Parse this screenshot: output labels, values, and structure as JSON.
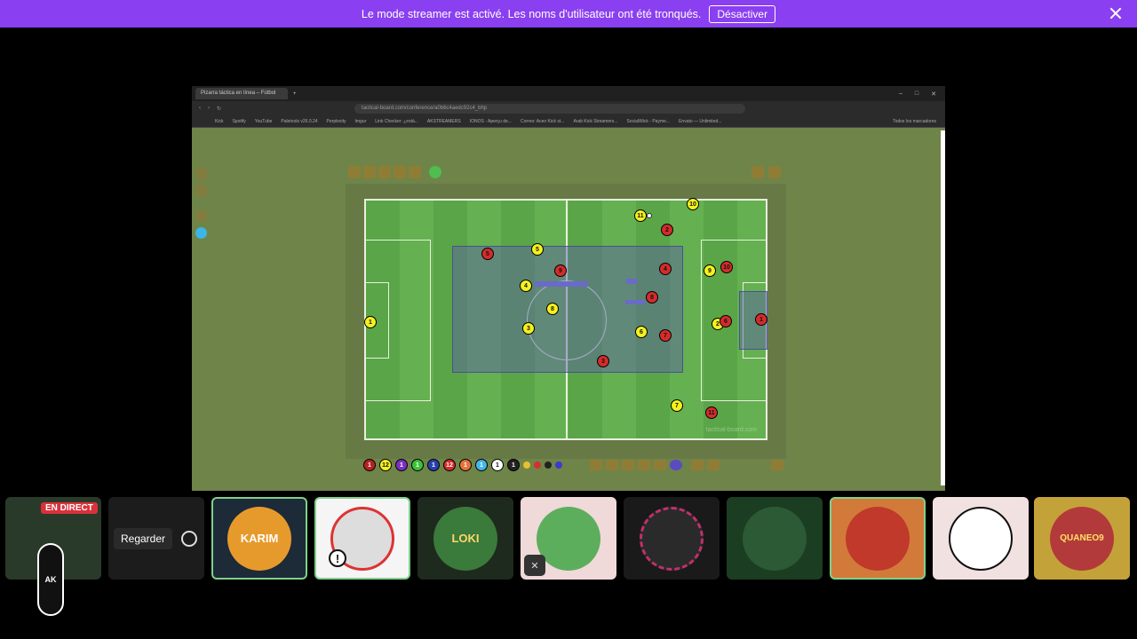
{
  "banner": {
    "message": "Le mode streamer est activé. Les noms d'utilisateur ont été tronqués.",
    "button": "Désactiver",
    "color": "#8a3ff0"
  },
  "shared_window": {
    "tab_title": "Pizarra táctica en línea – Fútbol",
    "address": "tactical-board.com/conference/a0b6c4aedc92c4_bhp",
    "bookmarks": [
      "Kick",
      "Spotify",
      "YouTube",
      "Paletools v26.0.24",
      "Perplexity",
      "Imgur",
      "Link Checker: ¿está...",
      "AKSTREAMERS",
      "IONOS - Aperçu de...",
      "Correo: Aceo Kick st...",
      "Arab Kick Streamers...",
      "SocialWick - Payme...",
      "Envato — Unlimited..."
    ],
    "bookmarks_end": "Todos los marcadores",
    "watermark": "tactical-board.com",
    "bottom_palette": [
      "1",
      "12",
      "1",
      "1",
      "1",
      "12",
      "1",
      "1",
      "1",
      "1"
    ]
  },
  "participants": {
    "live_label": "EN DIRECT",
    "watch_label": "Regarder",
    "tiles": [
      {
        "label": "KARIM"
      },
      {
        "label": ""
      },
      {
        "label": "LOKI"
      },
      {
        "label": ""
      },
      {
        "label": ""
      },
      {
        "label": ""
      },
      {
        "label": ""
      },
      {
        "label": ""
      },
      {
        "label": "QUANEO9"
      }
    ],
    "logo_text": "AK"
  }
}
